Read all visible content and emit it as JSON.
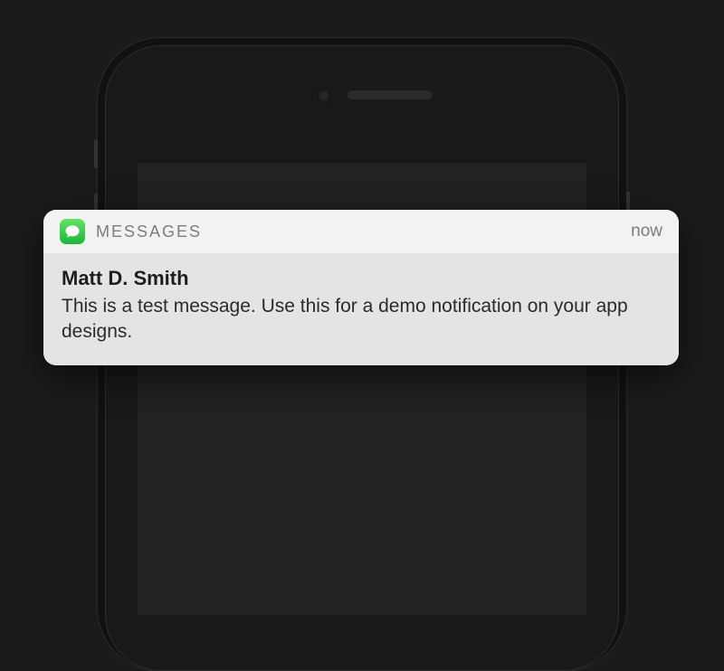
{
  "notification": {
    "app_name": "MESSAGES",
    "timestamp": "now",
    "sender": "Matt D. Smith",
    "message": "This is a test message. Use this for a demo notification on your app designs.",
    "icon": "messages-icon",
    "icon_color": "#2ecc40"
  }
}
